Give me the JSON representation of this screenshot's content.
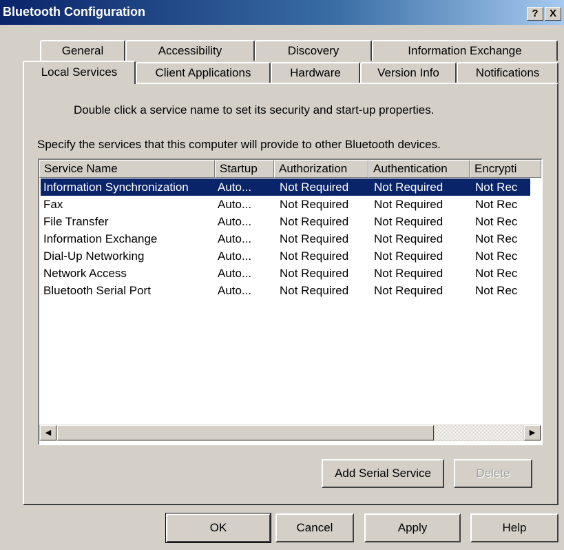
{
  "window": {
    "title": "Bluetooth Configuration",
    "help_label": "?",
    "close_label": "X"
  },
  "tabs": {
    "row1": [
      "General",
      "Accessibility",
      "Discovery",
      "Information Exchange"
    ],
    "row2": [
      "Local Services",
      "Client Applications",
      "Hardware",
      "Version Info",
      "Notifications"
    ],
    "active": "Local Services"
  },
  "panel": {
    "instruction": "Double click a service name to set its security and start-up properties.",
    "description": "Specify the services that this computer will provide to other Bluetooth devices."
  },
  "table": {
    "columns": [
      "Service Name",
      "Startup",
      "Authorization",
      "Authentication",
      "Encrypti"
    ],
    "rows": [
      [
        "Information Synchronization",
        "Auto...",
        "Not Required",
        "Not Required",
        "Not Rec"
      ],
      [
        "Fax",
        "Auto...",
        "Not Required",
        "Not Required",
        "Not Rec"
      ],
      [
        "File Transfer",
        "Auto...",
        "Not Required",
        "Not Required",
        "Not Rec"
      ],
      [
        "Information Exchange",
        "Auto...",
        "Not Required",
        "Not Required",
        "Not Rec"
      ],
      [
        "Dial-Up Networking",
        "Auto...",
        "Not Required",
        "Not Required",
        "Not Rec"
      ],
      [
        "Network Access",
        "Auto...",
        "Not Required",
        "Not Required",
        "Not Rec"
      ],
      [
        "Bluetooth Serial Port",
        "Auto...",
        "Not Required",
        "Not Required",
        "Not Rec"
      ]
    ],
    "selected_row": 0,
    "scroll_left_icon": "◀",
    "scroll_right_icon": "▶"
  },
  "actions": {
    "add_serial_service": "Add Serial Service",
    "delete": "Delete"
  },
  "footer": {
    "ok": "OK",
    "cancel": "Cancel",
    "apply": "Apply",
    "help": "Help"
  },
  "colors": {
    "selection": "#0a246a",
    "face": "#d4d0c8"
  }
}
